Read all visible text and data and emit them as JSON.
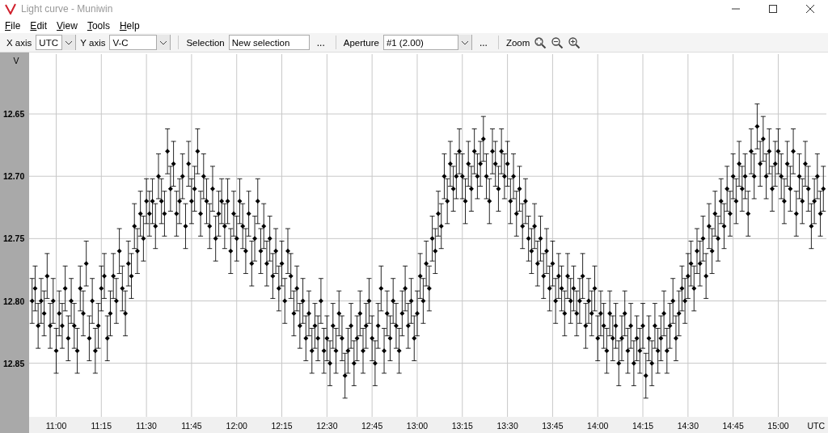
{
  "window": {
    "title": "Light curve - Muniwin"
  },
  "menu": [
    {
      "label": "File"
    },
    {
      "label": "Edit"
    },
    {
      "label": "View"
    },
    {
      "label": "Tools"
    },
    {
      "label": "Help"
    }
  ],
  "toolbar": {
    "x_axis": {
      "label": "X axis",
      "value": "UTC"
    },
    "y_axis": {
      "label": "Y axis",
      "value": "V-C"
    },
    "selection": {
      "label": "Selection",
      "value": "New selection",
      "more": "..."
    },
    "aperture": {
      "label": "Aperture",
      "value": "#1 (2.00)",
      "more": "..."
    },
    "zoom": {
      "label": "Zoom"
    }
  },
  "chart": {
    "chart_data": {
      "type": "scatter",
      "grid": true,
      "xlabel": "UTC",
      "ylabel": "V",
      "xlim": [
        651,
        916
      ],
      "ylim": [
        12.893,
        12.602
      ],
      "xticks": [
        {
          "value": 660,
          "label": "11:00"
        },
        {
          "value": 675,
          "label": "11:15"
        },
        {
          "value": 690,
          "label": "11:30"
        },
        {
          "value": 705,
          "label": "11:45"
        },
        {
          "value": 720,
          "label": "12:00"
        },
        {
          "value": 735,
          "label": "12:15"
        },
        {
          "value": 750,
          "label": "12:30"
        },
        {
          "value": 765,
          "label": "12:45"
        },
        {
          "value": 780,
          "label": "13:00"
        },
        {
          "value": 795,
          "label": "13:15"
        },
        {
          "value": 810,
          "label": "13:30"
        },
        {
          "value": 825,
          "label": "13:45"
        },
        {
          "value": 840,
          "label": "14:00"
        },
        {
          "value": 855,
          "label": "14:15"
        },
        {
          "value": 870,
          "label": "14:30"
        },
        {
          "value": 885,
          "label": "14:45"
        },
        {
          "value": 900,
          "label": "15:00"
        }
      ],
      "yticks": [
        {
          "value": 12.65,
          "label": "12.65"
        },
        {
          "value": 12.7,
          "label": "12.70"
        },
        {
          "value": 12.75,
          "label": "12.75"
        },
        {
          "value": 12.8,
          "label": "12.80"
        },
        {
          "value": 12.85,
          "label": "12.85"
        }
      ],
      "x": [
        652,
        653,
        654,
        655,
        656,
        657,
        658,
        659,
        660,
        661,
        662,
        663,
        664,
        665,
        666,
        667,
        668,
        669,
        670,
        671,
        672,
        673,
        674,
        675,
        676,
        677,
        678,
        679,
        680,
        681,
        682,
        683,
        684,
        685,
        686,
        687,
        688,
        689,
        690,
        691,
        692,
        693,
        694,
        695,
        696,
        697,
        698,
        699,
        700,
        701,
        702,
        703,
        704,
        705,
        706,
        707,
        708,
        709,
        710,
        711,
        712,
        713,
        714,
        715,
        716,
        717,
        718,
        719,
        720,
        721,
        722,
        723,
        724,
        725,
        726,
        727,
        728,
        729,
        730,
        731,
        732,
        733,
        734,
        735,
        736,
        737,
        738,
        739,
        740,
        741,
        742,
        743,
        744,
        745,
        746,
        747,
        748,
        749,
        750,
        751,
        752,
        753,
        754,
        755,
        756,
        757,
        758,
        759,
        760,
        761,
        762,
        763,
        764,
        765,
        766,
        767,
        768,
        769,
        770,
        771,
        772,
        773,
        774,
        775,
        776,
        777,
        778,
        779,
        780,
        781,
        782,
        783,
        784,
        785,
        786,
        787,
        788,
        789,
        790,
        791,
        792,
        793,
        794,
        795,
        796,
        797,
        798,
        799,
        800,
        801,
        802,
        803,
        804,
        805,
        806,
        807,
        808,
        809,
        810,
        811,
        812,
        813,
        814,
        815,
        816,
        817,
        818,
        819,
        820,
        821,
        822,
        823,
        824,
        825,
        826,
        827,
        828,
        829,
        830,
        831,
        832,
        833,
        834,
        835,
        836,
        837,
        838,
        839,
        840,
        841,
        842,
        843,
        844,
        845,
        846,
        847,
        848,
        849,
        850,
        851,
        852,
        853,
        854,
        855,
        856,
        857,
        858,
        859,
        860,
        861,
        862,
        863,
        864,
        865,
        866,
        867,
        868,
        869,
        870,
        871,
        872,
        873,
        874,
        875,
        876,
        877,
        878,
        879,
        880,
        881,
        882,
        883,
        884,
        885,
        886,
        887,
        888,
        889,
        890,
        891,
        892,
        893,
        894,
        895,
        896,
        897,
        898,
        899,
        900,
        901,
        902,
        903,
        904,
        905,
        906,
        907,
        908,
        909,
        910,
        911,
        912,
        913,
        914,
        915
      ],
      "series": [
        {
          "color": "#000000",
          "errors": [
            0.018,
            0.018,
            0.018,
            0.018,
            0.018,
            0.018,
            0.018,
            0.018,
            0.018,
            0.018,
            0.018,
            0.018,
            0.018,
            0.018,
            0.018,
            0.018,
            0.018,
            0.018,
            0.018,
            0.018,
            0.018,
            0.018,
            0.018,
            0.018,
            0.018,
            0.018,
            0.018,
            0.018,
            0.018,
            0.018,
            0.018,
            0.018,
            0.018,
            0.018,
            0.018,
            0.018,
            0.018,
            0.018,
            0.018,
            0.018,
            0.018,
            0.018,
            0.018,
            0.018,
            0.018,
            0.018,
            0.018,
            0.018,
            0.018,
            0.018,
            0.018,
            0.018,
            0.018,
            0.018,
            0.018,
            0.018,
            0.018,
            0.018,
            0.018,
            0.018,
            0.018,
            0.018,
            0.018,
            0.018,
            0.018,
            0.018,
            0.018,
            0.018,
            0.018,
            0.018,
            0.018,
            0.018,
            0.018,
            0.018,
            0.018,
            0.018,
            0.018,
            0.018,
            0.018,
            0.018,
            0.018,
            0.018,
            0.018,
            0.018,
            0.018,
            0.018,
            0.018,
            0.018,
            0.018,
            0.018,
            0.018,
            0.018,
            0.018,
            0.018,
            0.018,
            0.018,
            0.018,
            0.018,
            0.018,
            0.018,
            0.018,
            0.018,
            0.018,
            0.018,
            0.018,
            0.018,
            0.018,
            0.018,
            0.018,
            0.018,
            0.018,
            0.018,
            0.018,
            0.018,
            0.018,
            0.018,
            0.018,
            0.018,
            0.018,
            0.018,
            0.018,
            0.018,
            0.018,
            0.018,
            0.018,
            0.018,
            0.018,
            0.018,
            0.018,
            0.018,
            0.018,
            0.018,
            0.018,
            0.018,
            0.018,
            0.018,
            0.018,
            0.018,
            0.018,
            0.018,
            0.018,
            0.018,
            0.018,
            0.018,
            0.018,
            0.018,
            0.018,
            0.018,
            0.018,
            0.018,
            0.018,
            0.018,
            0.018,
            0.018,
            0.018,
            0.018,
            0.018,
            0.018,
            0.018,
            0.018,
            0.018,
            0.018,
            0.018,
            0.018,
            0.018,
            0.018,
            0.018,
            0.018,
            0.018,
            0.018,
            0.018,
            0.018,
            0.018,
            0.018,
            0.018,
            0.018,
            0.018,
            0.018,
            0.018,
            0.018,
            0.018,
            0.018,
            0.018,
            0.018,
            0.018,
            0.018,
            0.018,
            0.018,
            0.018,
            0.018,
            0.018,
            0.018,
            0.018,
            0.018,
            0.018,
            0.018,
            0.018,
            0.018,
            0.018,
            0.018,
            0.018,
            0.018,
            0.018,
            0.018,
            0.018,
            0.018,
            0.018,
            0.018,
            0.018,
            0.018,
            0.018,
            0.018,
            0.018,
            0.018,
            0.018,
            0.018,
            0.018,
            0.018,
            0.018,
            0.018,
            0.018,
            0.018,
            0.018,
            0.018,
            0.018,
            0.018,
            0.018,
            0.018,
            0.018,
            0.018,
            0.018,
            0.018,
            0.018,
            0.018,
            0.018,
            0.018,
            0.018,
            0.018,
            0.018,
            0.018,
            0.018,
            0.018,
            0.018,
            0.018,
            0.018,
            0.018,
            0.018,
            0.018,
            0.018,
            0.018,
            0.018,
            0.018,
            0.018,
            0.018,
            0.018,
            0.018,
            0.018,
            0.018,
            0.018,
            0.018,
            0.018,
            0.018,
            0.018,
            0.018
          ],
          "values": [
            12.8,
            12.79,
            12.82,
            12.8,
            12.81,
            12.78,
            12.82,
            12.8,
            12.84,
            12.81,
            12.82,
            12.79,
            12.83,
            12.8,
            12.82,
            12.84,
            12.79,
            12.81,
            12.77,
            12.83,
            12.8,
            12.84,
            12.82,
            12.79,
            12.78,
            12.83,
            12.81,
            12.78,
            12.8,
            12.76,
            12.79,
            12.81,
            12.77,
            12.78,
            12.74,
            12.76,
            12.73,
            12.75,
            12.72,
            12.73,
            12.72,
            12.74,
            12.7,
            12.72,
            12.73,
            12.68,
            12.71,
            12.69,
            12.73,
            12.72,
            12.7,
            12.74,
            12.69,
            12.72,
            12.71,
            12.68,
            12.73,
            12.7,
            12.72,
            12.74,
            12.71,
            12.75,
            12.73,
            12.72,
            12.74,
            12.72,
            12.76,
            12.73,
            12.75,
            12.72,
            12.74,
            12.76,
            12.73,
            12.77,
            12.75,
            12.72,
            12.76,
            12.74,
            12.77,
            12.75,
            12.78,
            12.76,
            12.79,
            12.77,
            12.8,
            12.76,
            12.78,
            12.81,
            12.79,
            12.82,
            12.8,
            12.83,
            12.81,
            12.84,
            12.82,
            12.83,
            12.8,
            12.84,
            12.83,
            12.85,
            12.82,
            12.84,
            12.81,
            12.83,
            12.86,
            12.84,
            12.82,
            12.85,
            12.83,
            12.81,
            12.84,
            12.82,
            12.8,
            12.83,
            12.85,
            12.82,
            12.79,
            12.84,
            12.81,
            12.83,
            12.8,
            12.82,
            12.84,
            12.81,
            12.79,
            12.82,
            12.8,
            12.83,
            12.81,
            12.78,
            12.8,
            12.77,
            12.79,
            12.75,
            12.76,
            12.73,
            12.74,
            12.7,
            12.72,
            12.69,
            12.71,
            12.7,
            12.68,
            12.7,
            12.72,
            12.69,
            12.71,
            12.68,
            12.7,
            12.69,
            12.67,
            12.7,
            12.72,
            12.68,
            12.69,
            12.71,
            12.68,
            12.7,
            12.69,
            12.72,
            12.7,
            12.73,
            12.71,
            12.74,
            12.72,
            12.75,
            12.76,
            12.74,
            12.77,
            12.75,
            12.78,
            12.76,
            12.79,
            12.77,
            12.8,
            12.78,
            12.79,
            12.81,
            12.78,
            12.8,
            12.79,
            12.81,
            12.8,
            12.78,
            12.82,
            12.8,
            12.81,
            12.79,
            12.83,
            12.81,
            12.82,
            12.84,
            12.81,
            12.83,
            12.82,
            12.85,
            12.83,
            12.81,
            12.84,
            12.82,
            12.85,
            12.83,
            12.84,
            12.82,
            12.86,
            12.83,
            12.85,
            12.82,
            12.84,
            12.83,
            12.81,
            12.84,
            12.82,
            12.8,
            12.83,
            12.81,
            12.79,
            12.8,
            12.78,
            12.77,
            12.79,
            12.76,
            12.77,
            12.75,
            12.78,
            12.74,
            12.76,
            12.73,
            12.75,
            12.72,
            12.74,
            12.71,
            12.73,
            12.7,
            12.72,
            12.69,
            12.71,
            12.7,
            12.73,
            12.68,
            12.7,
            12.66,
            12.69,
            12.67,
            12.7,
            12.68,
            12.71,
            12.69,
            12.68,
            12.7,
            12.72,
            12.69,
            12.71,
            12.68,
            12.73,
            12.7,
            12.72,
            12.69,
            12.71,
            12.74,
            12.72,
            12.7,
            12.73,
            12.71
          ]
        }
      ]
    }
  }
}
